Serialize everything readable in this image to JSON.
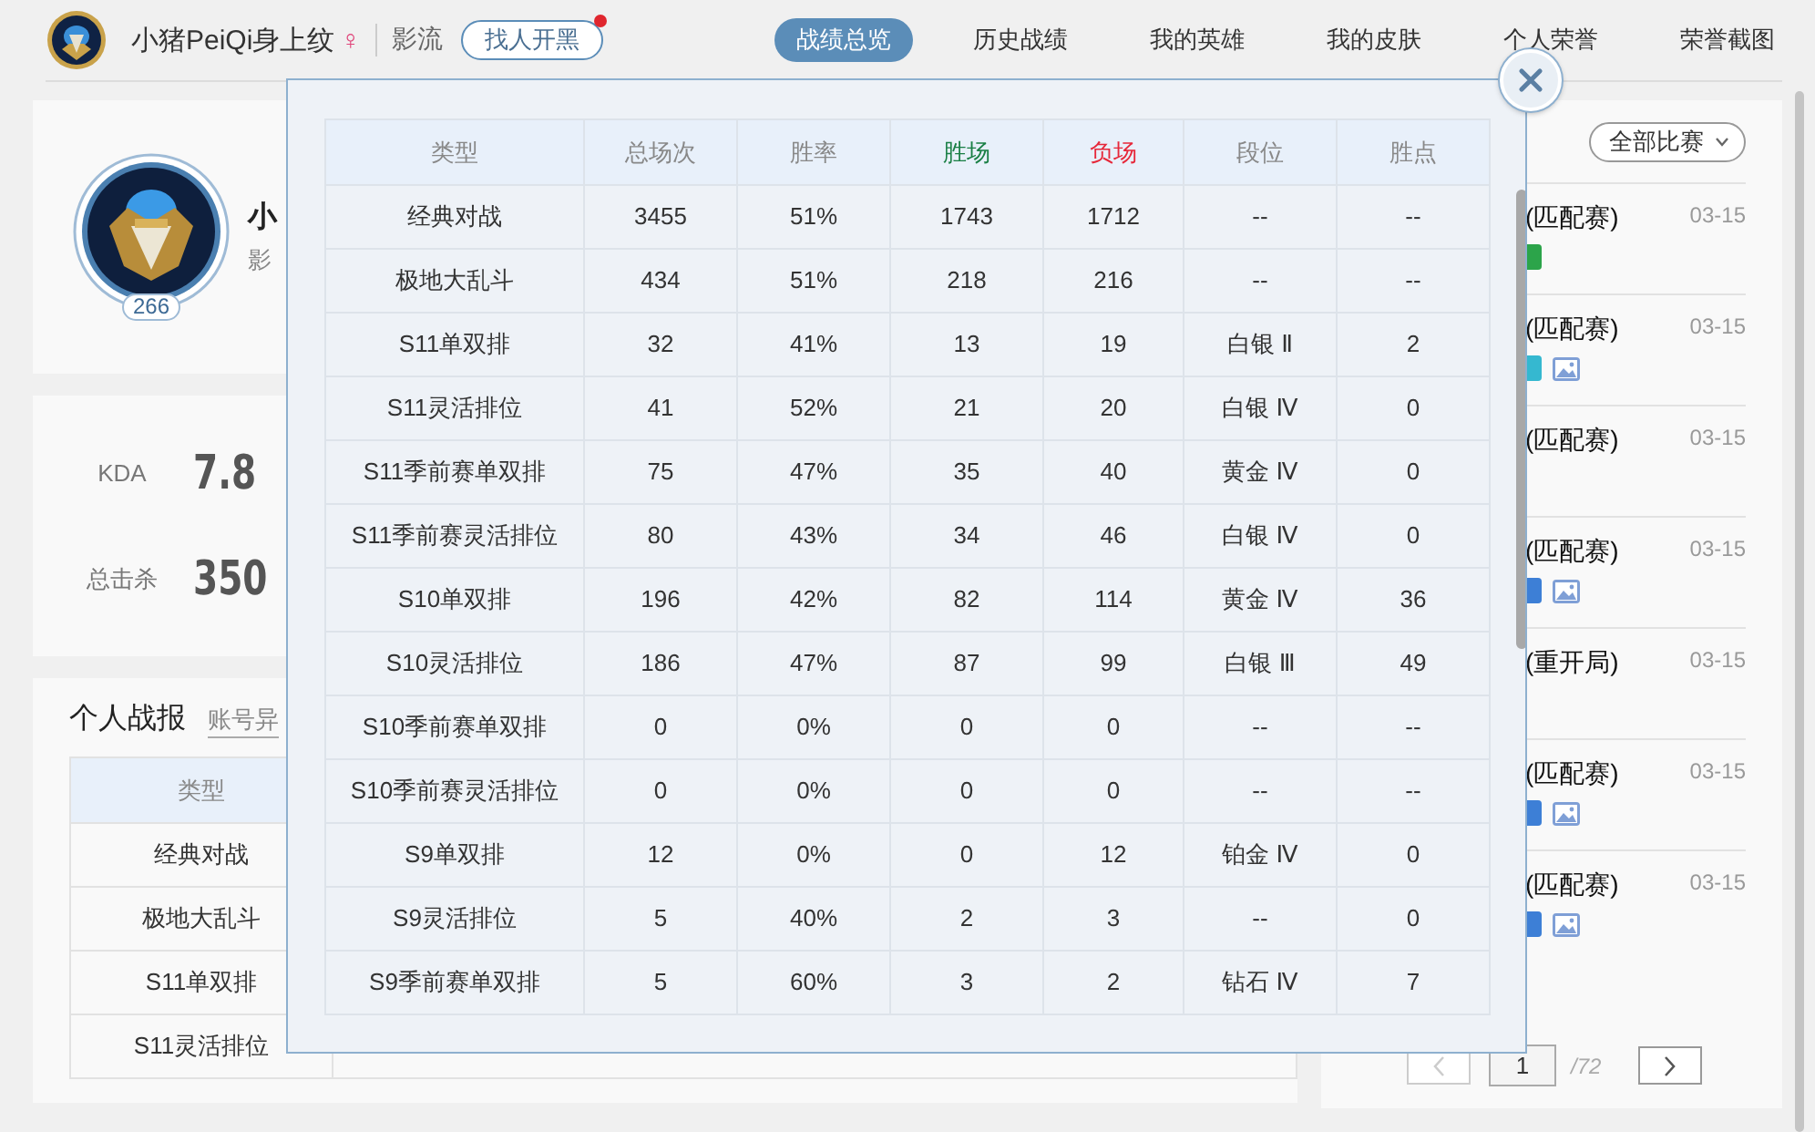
{
  "header": {
    "name": "小猪PeiQi身上纹",
    "gender_symbol": "♀",
    "server": "影流",
    "team_button": "找人开黑",
    "has_notification": true
  },
  "tabs": [
    {
      "label": "战绩总览",
      "selected": true
    },
    {
      "label": "历史战绩",
      "selected": false
    },
    {
      "label": "我的英雄",
      "selected": false
    },
    {
      "label": "我的皮肤",
      "selected": false
    },
    {
      "label": "个人荣誉",
      "selected": false
    },
    {
      "label": "荣誉截图",
      "selected": false
    }
  ],
  "profile": {
    "level": "266",
    "name": "小",
    "server": "影"
  },
  "stats": [
    {
      "label": "KDA",
      "value": "7.8"
    },
    {
      "label": "总击杀",
      "value": "350"
    }
  ],
  "report": {
    "title": "个人战报",
    "link": "账号异",
    "column": "类型",
    "rows": [
      "经典对战",
      "极地大乱斗",
      "S11单双排",
      "S11灵活排位"
    ]
  },
  "matches": {
    "filter": "全部比赛",
    "items": [
      {
        "mode": "(匹配赛)",
        "date": "03-15",
        "color": "#2ca44a",
        "has_image": false
      },
      {
        "mode": "(匹配赛)",
        "date": "03-15",
        "color": "#35b8d0",
        "has_image": true
      },
      {
        "mode": "(匹配赛)",
        "date": "03-15",
        "has_image": false
      },
      {
        "mode": "(匹配赛)",
        "date": "03-15",
        "color": "#3d7fd6",
        "has_image": true
      },
      {
        "mode": "(重开局)",
        "date": "03-15",
        "has_image": false
      },
      {
        "mode": "(匹配赛)",
        "date": "03-15",
        "color": "#3d7fd6",
        "has_image": true
      },
      {
        "mode": "(匹配赛)",
        "date": "03-15",
        "color": "#3d7fd6",
        "has_image": true
      }
    ],
    "pagination": {
      "page": "1",
      "total": "/72"
    }
  },
  "modal": {
    "columns": [
      {
        "label": "类型",
        "kind": "normal"
      },
      {
        "label": "总场次",
        "kind": "normal"
      },
      {
        "label": "胜率",
        "kind": "normal"
      },
      {
        "label": "胜场",
        "kind": "win"
      },
      {
        "label": "负场",
        "kind": "loss"
      },
      {
        "label": "段位",
        "kind": "normal"
      },
      {
        "label": "胜点",
        "kind": "normal"
      }
    ],
    "rows": [
      [
        "经典对战",
        "3455",
        "51%",
        "1743",
        "1712",
        "--",
        "--"
      ],
      [
        "极地大乱斗",
        "434",
        "51%",
        "218",
        "216",
        "--",
        "--"
      ],
      [
        "S11单双排",
        "32",
        "41%",
        "13",
        "19",
        "白银 Ⅱ",
        "2"
      ],
      [
        "S11灵活排位",
        "41",
        "52%",
        "21",
        "20",
        "白银 Ⅳ",
        "0"
      ],
      [
        "S11季前赛单双排",
        "75",
        "47%",
        "35",
        "40",
        "黄金 Ⅳ",
        "0"
      ],
      [
        "S11季前赛灵活排位",
        "80",
        "43%",
        "34",
        "46",
        "白银 Ⅳ",
        "0"
      ],
      [
        "S10单双排",
        "196",
        "42%",
        "82",
        "114",
        "黄金 Ⅳ",
        "36"
      ],
      [
        "S10灵活排位",
        "186",
        "47%",
        "87",
        "99",
        "白银 Ⅲ",
        "49"
      ],
      [
        "S10季前赛单双排",
        "0",
        "0%",
        "0",
        "0",
        "--",
        "--"
      ],
      [
        "S10季前赛灵活排位",
        "0",
        "0%",
        "0",
        "0",
        "--",
        "--"
      ],
      [
        "S9单双排",
        "12",
        "0%",
        "0",
        "12",
        "铂金 Ⅳ",
        "0"
      ],
      [
        "S9灵活排位",
        "5",
        "40%",
        "2",
        "3",
        "--",
        "0"
      ],
      [
        "S9季前赛单双排",
        "5",
        "60%",
        "3",
        "2",
        "钻石 Ⅳ",
        "7"
      ]
    ]
  }
}
